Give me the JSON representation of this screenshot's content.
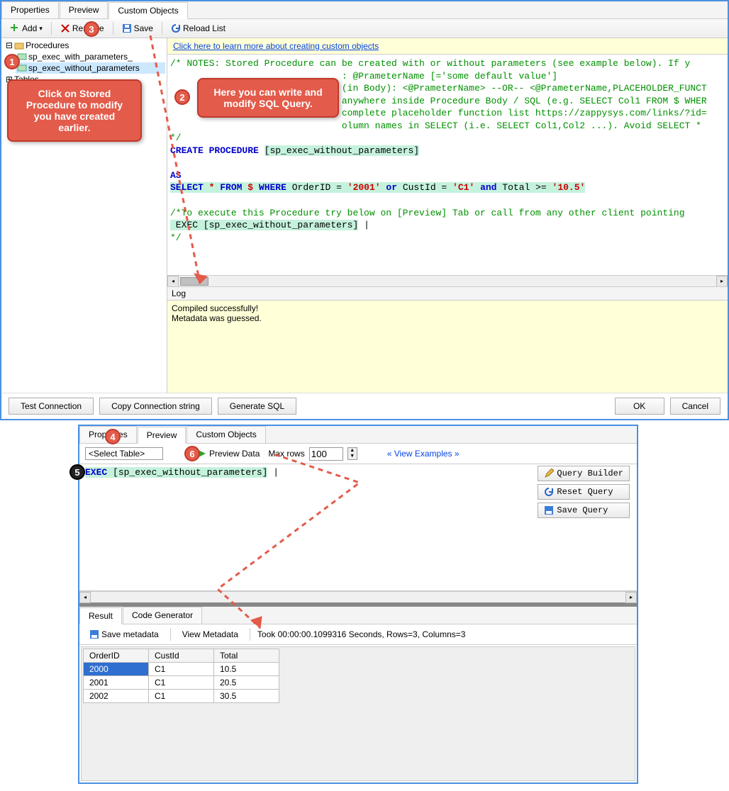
{
  "top": {
    "tabs": [
      "Properties",
      "Preview",
      "Custom Objects"
    ],
    "activeTab": 2,
    "toolbar": {
      "add": "Add",
      "remove": "Remove",
      "save": "Save",
      "reload": "Reload List"
    },
    "tree": {
      "root": "Procedures",
      "items": [
        "sp_exec_with_parameters_",
        "sp_exec_without_parameters"
      ],
      "next": "Tables"
    },
    "helpLink": "Click here to learn more about creating custom objects",
    "code": {
      "c1": "/* NOTES: Stored Procedure can be created with or without parameters (see example below). If y",
      "c2a": "                               ",
      "c2b": ": @PrameterName [='some default value']",
      "c3": " (in Body): <@PrameterName> --OR-- <@PrameterName,PLACEHOLDER_FUNCT",
      "c4": " anywhere inside Procedure Body / SQL (e.g. SELECT Col1 FROM $ WHER",
      "c5": " complete placeholder function list https://zappysys.com/links/?id=",
      "c6": "olumn names in SELECT (i.e. SELECT Col1,Col2 ...). Avoid SELECT * ",
      "c7": "*/",
      "kw_create": "CREATE",
      "kw_proc": "PROCEDURE",
      "procname": "[sp_exec_without_parameters]",
      "kw_as": "AS",
      "kw_select": "SELECT",
      "star": "*",
      "kw_from": "FROM",
      "dollar": "$",
      "kw_where": "WHERE",
      "cond1a": "OrderID =",
      "cond1b": "'2001'",
      "kw_or": "or",
      "cond2a": "CustId =",
      "cond2b": "'C1'",
      "kw_and": "and",
      "cond3a": "Total >=",
      "cond3b": "'10.5'",
      "c8": "/*To execute this Procedure try below on [Preview] Tab or call from any other client pointing",
      "exec": " EXEC [sp_exec_without_parameters]",
      "c9": "*/"
    },
    "logLabel": "Log",
    "log": [
      "Compiled successfully!",
      "Metadata was guessed."
    ],
    "buttons": {
      "test": "Test Connection",
      "copy": "Copy Connection string",
      "gen": "Generate SQL",
      "ok": "OK",
      "cancel": "Cancel"
    }
  },
  "callouts": {
    "one": "Click on Stored Procedure to modify you have created earlier.",
    "two": "Here you can write and modify SQL Query."
  },
  "badges": {
    "b1": "1",
    "b2": "2",
    "b3": "3",
    "b4": "4",
    "b5": "5",
    "b6": "6"
  },
  "bottom": {
    "tabs": [
      "Properties",
      "Preview",
      "Custom Objects"
    ],
    "activeTab": 1,
    "selectTable": "<Select Table>",
    "previewData": "Preview Data",
    "maxRowsLabel": "Max rows",
    "maxRows": "100",
    "viewExamples": "« View Examples »",
    "queryBuilder": "Query Builder",
    "resetQuery": "Reset Query",
    "saveQuery": "Save Query",
    "execLine": "EXEC",
    "execTarget": "[sp_exec_without_parameters]",
    "resultTabs": [
      "Result",
      "Code Generator"
    ],
    "saveMeta": "Save metadata",
    "viewMeta": "View Metadata",
    "timing": "Took 00:00:00.1099316 Seconds, Rows=3, Columns=3",
    "columns": [
      "OrderID",
      "CustId",
      "Total"
    ],
    "rows": [
      [
        "2000",
        "C1",
        "10.5"
      ],
      [
        "2001",
        "C1",
        "20.5"
      ],
      [
        "2002",
        "C1",
        "30.5"
      ]
    ]
  }
}
